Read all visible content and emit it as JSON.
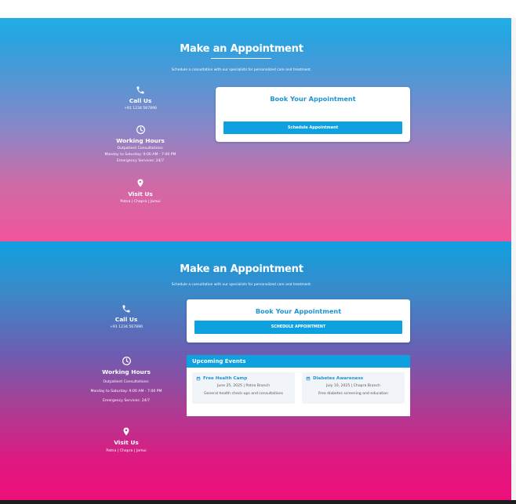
{
  "section1": {
    "title": "Make an Appointment",
    "subtitle": "Schedule a consultation with our specialists for personalized care and treatment.",
    "call": {
      "icon": "phone-icon",
      "heading": "Call Us",
      "phone": "+91 1234 567890"
    },
    "hours": {
      "icon": "clock-icon",
      "heading": "Working Hours",
      "line1": "Outpatient Consultations:",
      "line2": "Monday to Saturday: 9:00 AM - 7:00 PM",
      "line3": "Emergency Services: 24/7"
    },
    "visit": {
      "icon": "map-pin-icon",
      "heading": "Visit Us",
      "locations": "Patna | Chapra | Jamui"
    },
    "card": {
      "title": "Book Your Appointment",
      "button": "Schedule Appointment"
    }
  },
  "section2": {
    "title": "Make an Appointment",
    "subtitle": "Schedule a consultation with our specialists for personalized care and treatment.",
    "call": {
      "icon": "phone-icon",
      "heading": "Call Us",
      "phone": "+91 1234 567890"
    },
    "hours": {
      "icon": "clock-icon",
      "heading": "Working Hours",
      "line1": "Outpatient Consultations:",
      "line2": "Monday to Saturday: 9:00 AM - 7:00 PM",
      "line3": "Emergency Services: 24/7"
    },
    "visit": {
      "icon": "map-pin-icon",
      "heading": "Visit Us",
      "locations": "Patna | Chapra | Jamui"
    },
    "card": {
      "title": "Book Your Appointment",
      "button": "SCHEDULE APPOINTMENT"
    },
    "events": {
      "heading": "Upcoming Events",
      "items": [
        {
          "icon": "calendar-icon",
          "title": "Free Health Camp",
          "date": "June 25, 2025 | Patna Branch",
          "desc": "General health check-ups and consultations"
        },
        {
          "icon": "calendar-icon",
          "title": "Diabetes Awareness",
          "date": "July 10, 2025 | Chapra Branch",
          "desc": "Free diabetes screening and education"
        }
      ]
    }
  },
  "colors": {
    "accent": "#0ea1df",
    "title_blue": "#1e94d2",
    "pink": "#ee0f79"
  }
}
